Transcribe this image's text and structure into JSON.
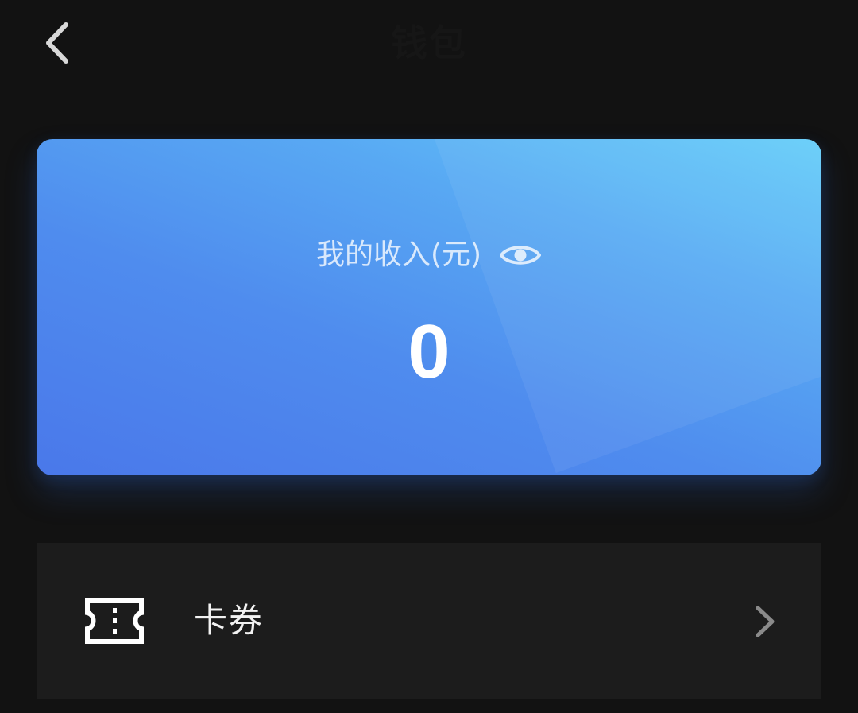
{
  "header": {
    "title": "钱包",
    "back_icon": "chevron-left-icon"
  },
  "income_card": {
    "label": "我的收入(元)",
    "amount": "0",
    "visibility_icon": "eye-icon",
    "gradient_colors": [
      "#4a78ea",
      "#64cdf9"
    ]
  },
  "menu": {
    "items": [
      {
        "icon": "ticket-icon",
        "label": "卡券",
        "trailing_icon": "chevron-right-icon"
      }
    ]
  },
  "colors": {
    "background": "#121212",
    "row_background": "#1c1c1c"
  }
}
